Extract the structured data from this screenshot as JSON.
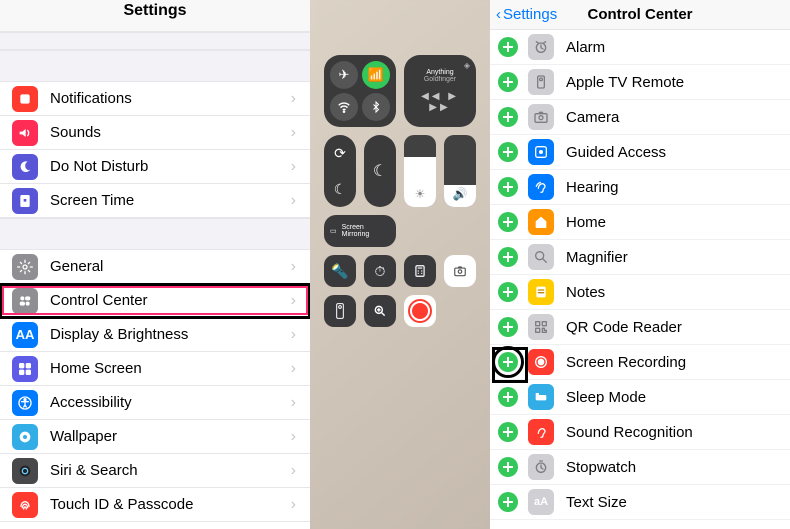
{
  "settings": {
    "title": "Settings",
    "groups": [
      [
        {
          "key": "notifications",
          "label": "Notifications",
          "icon": "notifications-icon",
          "bg": "bg-red"
        },
        {
          "key": "sounds",
          "label": "Sounds",
          "icon": "sounds-icon",
          "bg": "bg-pink"
        },
        {
          "key": "dnd",
          "label": "Do Not Disturb",
          "icon": "dnd-icon",
          "bg": "bg-purple"
        },
        {
          "key": "screentime",
          "label": "Screen Time",
          "icon": "screentime-icon",
          "bg": "bg-purple"
        }
      ],
      [
        {
          "key": "general",
          "label": "General",
          "icon": "general-icon",
          "bg": "bg-gray"
        },
        {
          "key": "controlcenter",
          "label": "Control Center",
          "icon": "controlcenter-icon",
          "bg": "bg-gray",
          "highlight": true
        },
        {
          "key": "display",
          "label": "Display & Brightness",
          "icon": "display-icon",
          "bg": "bg-blue"
        },
        {
          "key": "homescreen",
          "label": "Home Screen",
          "icon": "homescreen-icon",
          "bg": "bg-indigo"
        },
        {
          "key": "accessibility",
          "label": "Accessibility",
          "icon": "accessibility-icon",
          "bg": "bg-blue"
        },
        {
          "key": "wallpaper",
          "label": "Wallpaper",
          "icon": "wallpaper-icon",
          "bg": "bg-teal"
        },
        {
          "key": "siri",
          "label": "Siri & Search",
          "icon": "siri-icon",
          "bg": "bg-darkgray"
        },
        {
          "key": "touchid",
          "label": "Touch ID & Passcode",
          "icon": "touchid-icon",
          "bg": "bg-red"
        }
      ]
    ]
  },
  "cc_preview": {
    "music_title": "Anything",
    "music_sub": "Goldfinger",
    "mirror": "Screen Mirroring"
  },
  "ccc": {
    "back": "Settings",
    "title": "Control Center",
    "items": [
      {
        "key": "alarm",
        "label": "Alarm",
        "icon": "alarm-icon",
        "bg": "bg-lgray"
      },
      {
        "key": "appletv",
        "label": "Apple TV Remote",
        "icon": "appletv-icon",
        "bg": "bg-lgray"
      },
      {
        "key": "camera",
        "label": "Camera",
        "icon": "camera-icon",
        "bg": "bg-lgray"
      },
      {
        "key": "guided",
        "label": "Guided Access",
        "icon": "guided-icon",
        "bg": "bg-blue"
      },
      {
        "key": "hearing",
        "label": "Hearing",
        "icon": "hearing-icon",
        "bg": "bg-blue"
      },
      {
        "key": "home",
        "label": "Home",
        "icon": "home-icon",
        "bg": "bg-orange"
      },
      {
        "key": "magnifier",
        "label": "Magnifier",
        "icon": "magnifier-icon",
        "bg": "bg-lgray"
      },
      {
        "key": "notes",
        "label": "Notes",
        "icon": "notes-icon",
        "bg": "bg-yellow"
      },
      {
        "key": "qr",
        "label": "QR Code Reader",
        "icon": "qr-icon",
        "bg": "bg-lgray"
      },
      {
        "key": "screenrec",
        "label": "Screen Recording",
        "icon": "screenrec-icon",
        "bg": "bg-red",
        "boxed": true
      },
      {
        "key": "sleep",
        "label": "Sleep Mode",
        "icon": "sleep-icon",
        "bg": "bg-teal"
      },
      {
        "key": "soundrec",
        "label": "Sound Recognition",
        "icon": "soundrec-icon",
        "bg": "bg-red"
      },
      {
        "key": "stopwatch",
        "label": "Stopwatch",
        "icon": "stopwatch-icon",
        "bg": "bg-lgray"
      },
      {
        "key": "textsize",
        "label": "Text Size",
        "icon": "textsize-icon",
        "bg": "bg-lgray"
      }
    ]
  }
}
